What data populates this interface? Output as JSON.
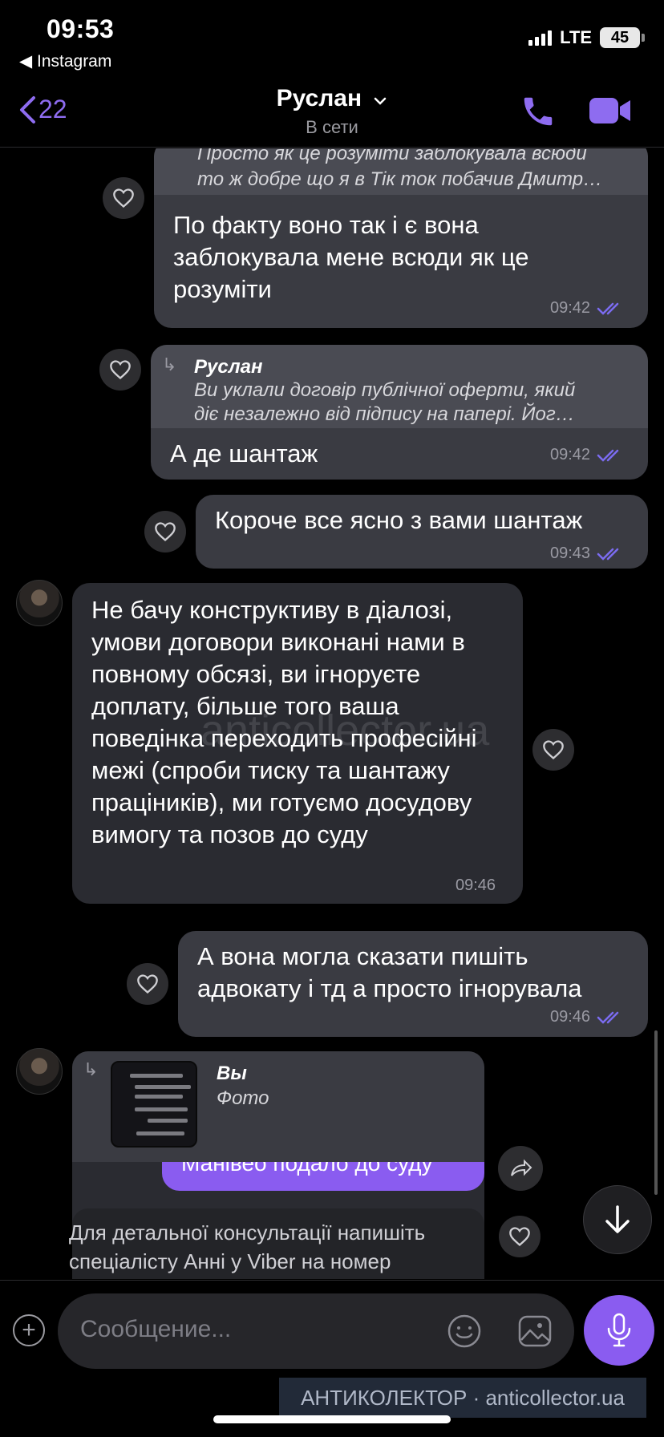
{
  "status_bar": {
    "time": "09:53",
    "back_app": "◀ Instagram",
    "network": "LTE",
    "battery": "45"
  },
  "header": {
    "back_count": "22",
    "contact_name": "Руслан",
    "status": "В сети"
  },
  "messages": [
    {
      "quote_line1": "Просто як це розуміти заблокувала всюди",
      "quote_line2": "то ж добре що я в Тік ток побачив Дмитр…",
      "text": "По факту воно так і є вона заблокувала мене всюди як це розуміти",
      "time": "09:42"
    },
    {
      "reply_name": "Руслан",
      "reply_line1": "Ви уклали договір публічної оферти, який",
      "reply_line2": "діє незалежно від підпису на папері. Йог…",
      "text": "А де шантаж",
      "time": "09:42"
    },
    {
      "text": "Короче все ясно з вами шантаж",
      "time": "09:43"
    },
    {
      "text": "Не бачу конструктиву в діалозі, умови договори виконані нами в повному обсязі, ви ігноруєте доплату, більше того ваша поведінка переходить професійні межі (спроби тиску та шантажу праціників), ми готуємо досудову вимогу та позов до суду",
      "time": "09:46"
    },
    {
      "text": "А вона могла сказати пишіть адвокату і тд а просто ігнорувала",
      "time": "09:46"
    },
    {
      "reply_name": "Вы",
      "reply_type": "Фото",
      "partial_purple_text": "Манівео подало до суду",
      "partial_text": "Для детальної консультації напишіть спеціалісту Анні у Viber на номер"
    }
  ],
  "watermark": "anticollector.ua",
  "input": {
    "placeholder": "Сообщение..."
  },
  "footer_banner": "АНТИКОЛЕКТОР · anticollector.ua",
  "colors": {
    "accent": "#8a5cf0",
    "bubble_out": "#3a3b42",
    "bubble_in": "#2a2b31"
  },
  "icons": [
    "chevron-left-icon",
    "phone-icon",
    "video-camera-icon",
    "heart-icon",
    "double-check-icon",
    "reply-arrow-icon",
    "share-icon",
    "arrow-down-icon",
    "plus-icon",
    "emoji-icon",
    "gallery-icon",
    "microphone-icon"
  ]
}
